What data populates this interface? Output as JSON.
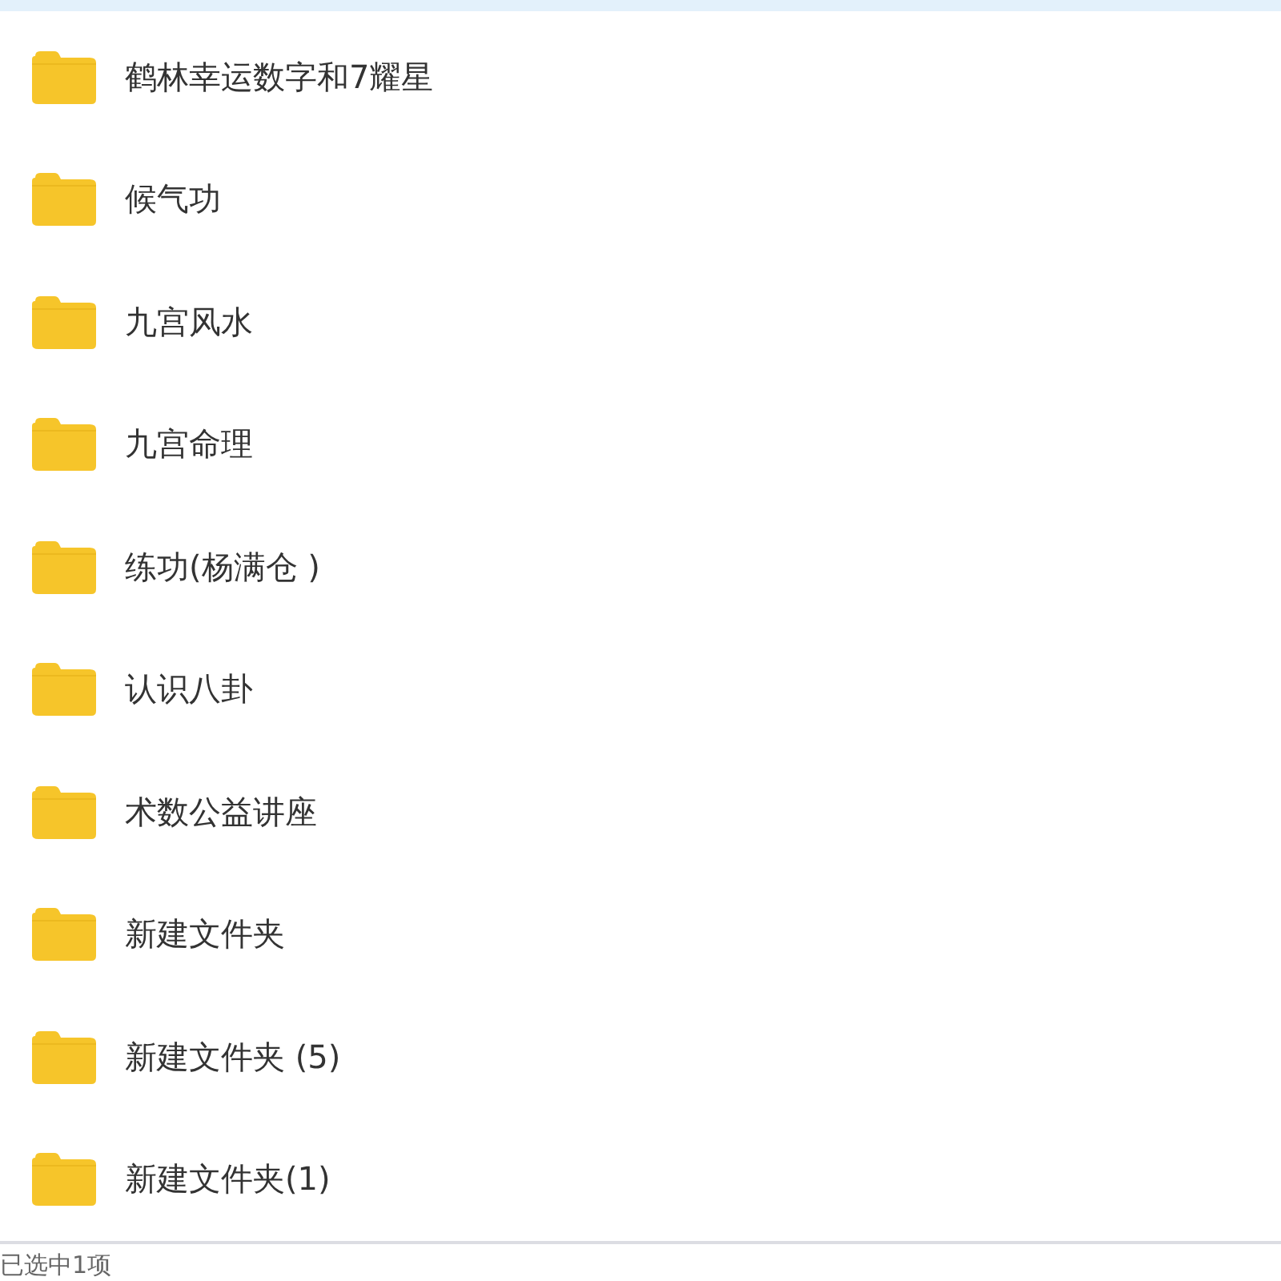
{
  "folders": [
    {
      "name": "鹤林幸运数字和7耀星"
    },
    {
      "name": "候气功"
    },
    {
      "name": "九宫风水"
    },
    {
      "name": "九宫命理"
    },
    {
      "name": "练功(杨满仓 )"
    },
    {
      "name": "认识八卦"
    },
    {
      "name": "术数公益讲座"
    },
    {
      "name": "新建文件夹"
    },
    {
      "name": "新建文件夹 (5)"
    },
    {
      "name": "新建文件夹(1)"
    }
  ],
  "status_bar": {
    "text": "已选中1项"
  }
}
